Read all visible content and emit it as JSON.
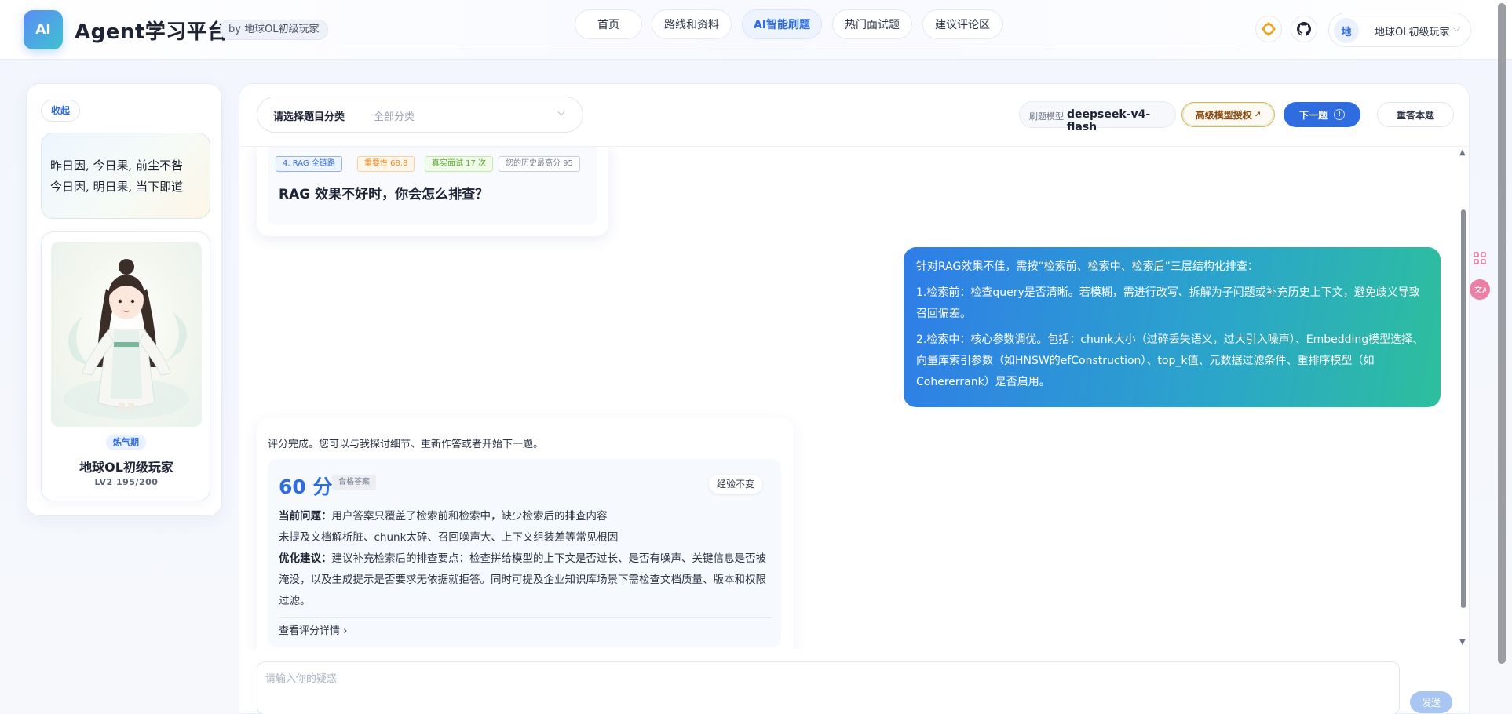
{
  "header": {
    "logo_text": "AI",
    "title": "Agent学习平台",
    "byline": "by 地球OL初级玩家",
    "nav": [
      {
        "label": "首页",
        "active": false
      },
      {
        "label": "路线和资料",
        "active": false
      },
      {
        "label": "AI智能刷题",
        "active": true
      },
      {
        "label": "热门面试题",
        "active": false
      },
      {
        "label": "建议评论区",
        "active": false
      }
    ],
    "icons": [
      "theme-icon",
      "github-icon"
    ],
    "user": {
      "avatar_char": "地",
      "name": "地球OL初级玩家",
      "chevron": "⌵"
    }
  },
  "sidebar": {
    "collapse_label": "收起",
    "quote_lines": [
      "昨日因, 今日果, 前尘不咎",
      "今日因, 明日果, 当下即道"
    ],
    "profile": {
      "rank": "炼气期",
      "name": "地球OL初级玩家",
      "level": "LV2 195/200"
    }
  },
  "toolbar": {
    "category_label": "请选择题目分类",
    "category_value": "全部分类",
    "model_label": "刷题模型",
    "model_name": "deepseek-v4-flash",
    "premium_label": "高级模型授权",
    "next_label": "下一题",
    "redo_label": "重答本题"
  },
  "question": {
    "tags": [
      {
        "text": "4. RAG 全链路",
        "style": "blue"
      },
      {
        "text": "重要性 68.8",
        "style": "orange"
      },
      {
        "text": "真实面试 17 次",
        "style": "green"
      },
      {
        "text": "您的历史最高分 95",
        "style": "gray"
      }
    ],
    "title": "RAG 效果不好时，你会怎么排查？"
  },
  "answer": {
    "paragraphs": [
      "针对RAG效果不佳，需按“检索前、检索中、检索后”三层结构化排查：",
      "1.检索前：检查query是否清晰。若模糊，需进行改写、拆解为子问题或补充历史上下文，避免歧义导致召回偏差。",
      "2.检索中：核心参数调优。包括：chunk大小（过碎丢失语义，过大引入噪声）、Embedding模型选择、向量库索引参数（如HNSW的efConstruction）、top_k值、元数据过滤条件、重排序模型（如Cohererrank）是否启用。"
    ]
  },
  "grade": {
    "intro": "评分完成。您可以与我探讨细节、重新作答或者开始下一题。",
    "score": "60 分",
    "score_tag": "合格答案",
    "exp_tag": "经验不变",
    "issue_label": "当前问题：",
    "issue_line1": "用户答案只覆盖了检索前和检索中，缺少检索后的排查内容",
    "issue_line2": "未提及文档解析脏、chunk太碎、召回噪声大、上下文组装差等常见根因",
    "advice_label": "优化建议：",
    "advice_text": "建议补充检索后的排查要点：检查拼给模型的上下文是否过长、是否有噪声、关键信息是否被淹没，以及生成提示是否要求无依据就拒答。同时可提及企业知识库场景下需检查文档质量、版本和权限过滤。",
    "detail_link": "查看评分详情"
  },
  "input": {
    "placeholder": "请输入你的疑惑",
    "send_label": "发送"
  },
  "colors": {
    "accent": "#2f6ce0",
    "bubble_start": "#2f7de8",
    "bubble_end": "#2dbf9d"
  }
}
